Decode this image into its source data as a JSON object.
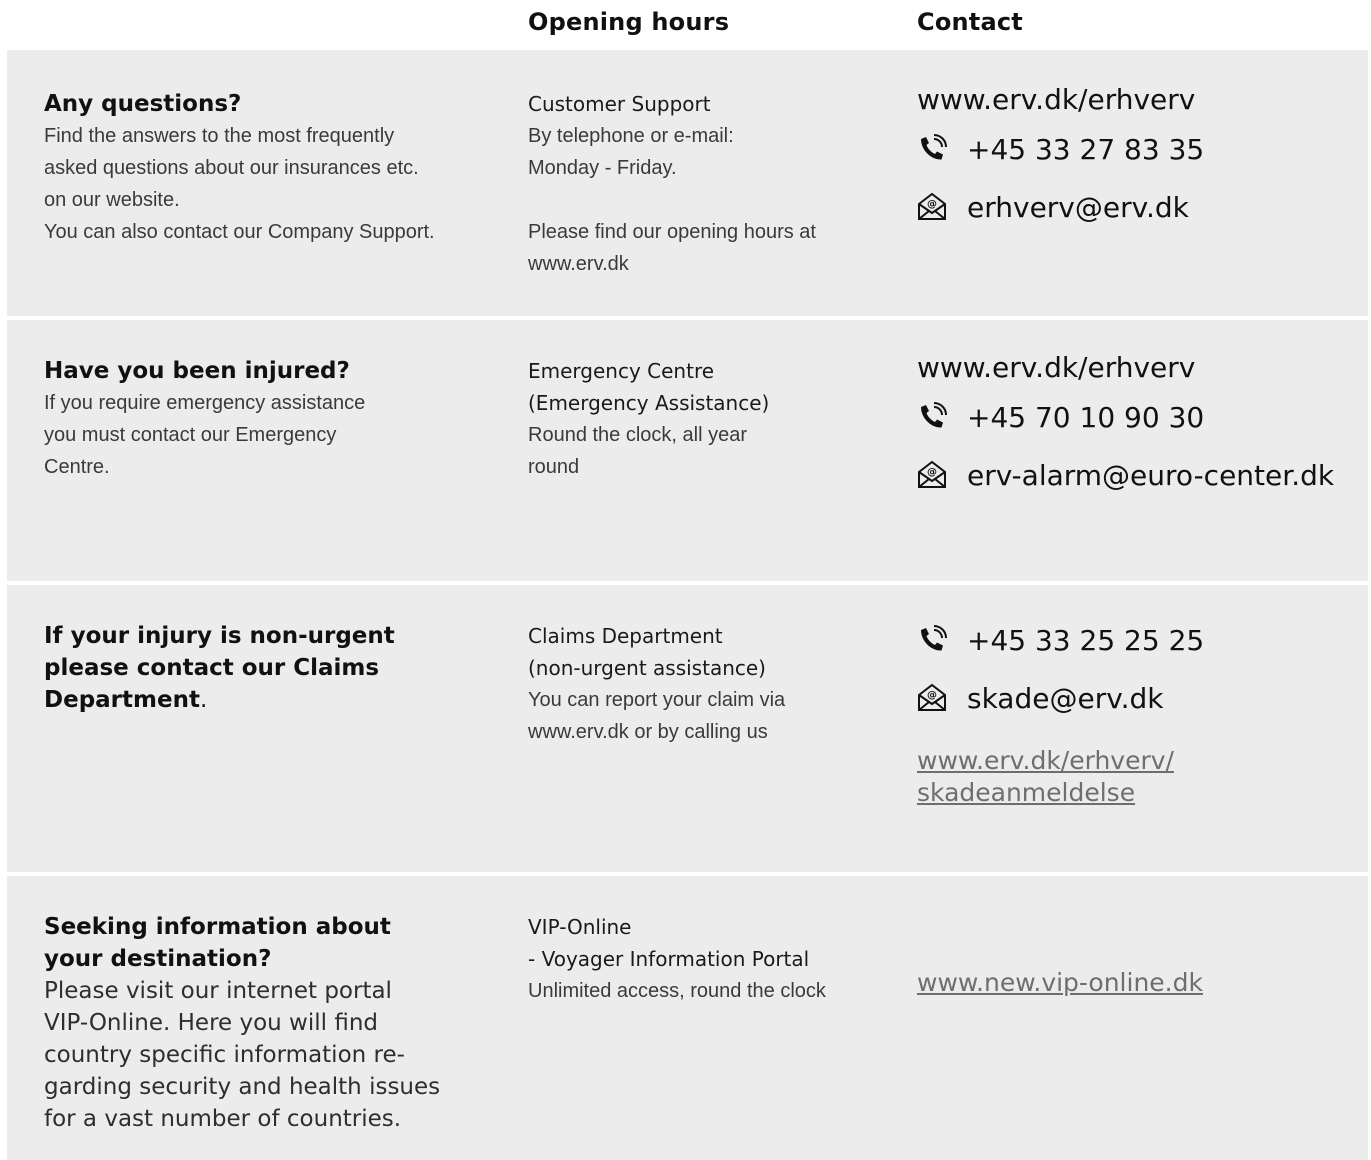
{
  "header": {
    "opening_hours": "Opening hours",
    "contact": "Contact"
  },
  "sections": [
    {
      "title": "Any questions?",
      "body": [
        "Find the answers to the most frequently",
        "asked questions about our insurances etc.",
        "on our website.",
        "You can also contact our Company Support."
      ],
      "department": [
        "Customer Support"
      ],
      "details": [
        "By telephone or e-mail:",
        "Monday - Friday."
      ],
      "details2": [
        "Please find our opening hours at",
        "www.erv.dk"
      ],
      "website": "www.erv.dk/erhverv",
      "phone": "+45 33 27 83 35",
      "email": "erhverv@erv.dk"
    },
    {
      "title": "Have you been injured?",
      "body": [
        "If you require emergency assistance",
        "you must contact our Emergency",
        "Centre."
      ],
      "department": [
        "Emergency Centre",
        "(Emergency Assistance)"
      ],
      "details": [
        "Round the clock, all year",
        "round"
      ],
      "website": "www.erv.dk/erhverv",
      "phone": "+45 70 10 90 30",
      "email": "erv-alarm@euro-center.dk"
    },
    {
      "title_lines": [
        "If your injury is non-urgent",
        "please contact our Claims",
        "Department"
      ],
      "title_suffix": ".",
      "department": [
        "Claims Department",
        "(non-urgent assistance)"
      ],
      "details": [
        "You can report your claim via",
        "www.erv.dk or by calling us"
      ],
      "phone": "+45 33 25 25 25",
      "email": "skade@erv.dk",
      "link_lines": [
        "www.erv.dk/erhverv/",
        "skadeanmeldelse"
      ]
    },
    {
      "title_lines": [
        "Seeking information about",
        "your destination?"
      ],
      "body": [
        "Please visit our internet portal",
        "VIP-Online. Here you will find",
        "country specific information re-",
        "garding security and health issues",
        "for a vast number of countries."
      ],
      "department": [
        "VIP-Online",
        "- Voyager Information Portal"
      ],
      "details": [
        "Unlimited access, round the clock"
      ],
      "link": "www.new.vip-online.dk"
    }
  ],
  "icons": {
    "phone": "phone-icon",
    "email": "email-envelope-icon"
  },
  "colors": {
    "band": "#ececec",
    "text": "#1a1a1a",
    "link": "#6e6e6e"
  }
}
